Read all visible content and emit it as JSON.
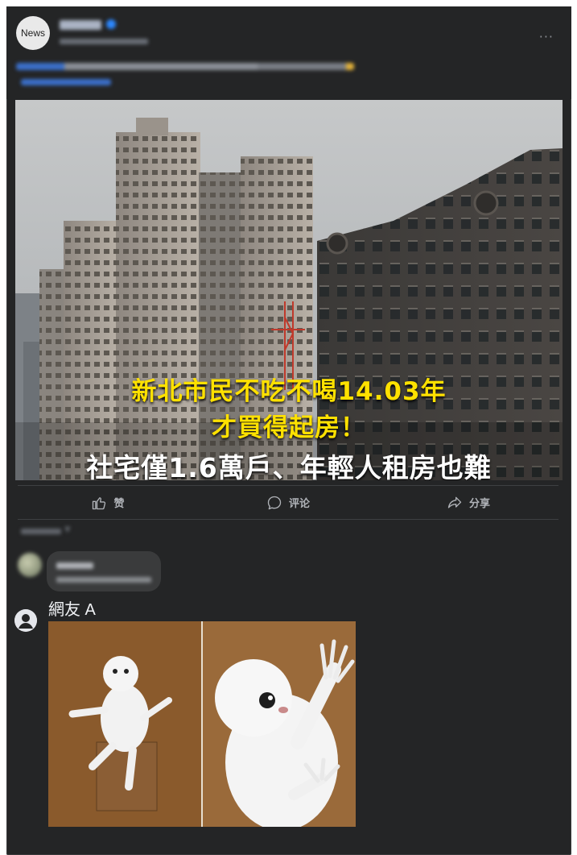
{
  "post": {
    "avatar_text": "News",
    "more_label": "···",
    "image_caption": {
      "line1": "新北市民不吃不喝14.03年",
      "line2": "才買得起房！",
      "line3": "社宅僅1.6萬戶、年輕人租房也難"
    }
  },
  "actions": {
    "like": "赞",
    "comment": "评论",
    "share": "分享"
  },
  "comments": {
    "sort_chevron": "▼",
    "reply_user_name": "網友 A"
  },
  "colors": {
    "card_bg": "#242526",
    "caption_yellow": "#ffe100",
    "action_text": "#b0b3b8"
  }
}
